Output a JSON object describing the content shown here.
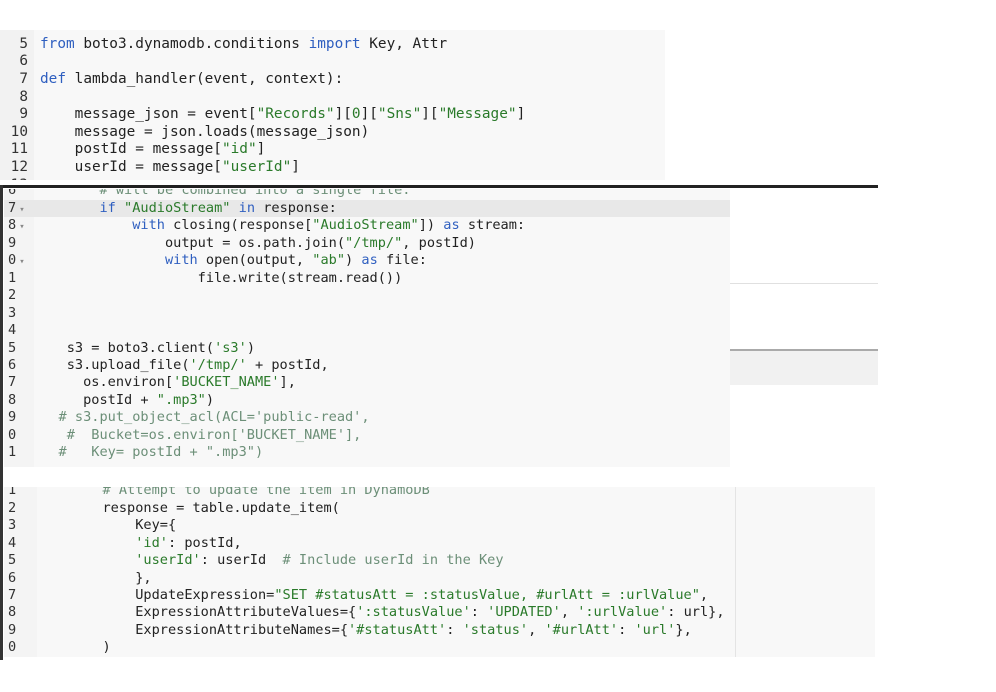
{
  "panels": [
    {
      "id": "p1",
      "lines": [
        {
          "num": "5",
          "tokens": [
            [
              "kw",
              "from"
            ],
            [
              "txt",
              " boto3.dynamodb.conditions "
            ],
            [
              "kw",
              "import"
            ],
            [
              "txt",
              " Key, Attr"
            ]
          ]
        },
        {
          "num": "6",
          "tokens": []
        },
        {
          "num": "7",
          "tokens": [
            [
              "kw",
              "def"
            ],
            [
              "txt",
              " lambda_handler(event, context):"
            ]
          ]
        },
        {
          "num": "8",
          "tokens": []
        },
        {
          "num": "9",
          "tokens": [
            [
              "txt",
              "    message_json = event["
            ],
            [
              "str",
              "\"Records\""
            ],
            [
              "txt",
              "]["
            ],
            [
              "num",
              "0"
            ],
            [
              "txt",
              "]["
            ],
            [
              "str",
              "\"Sns\""
            ],
            [
              "txt",
              "]["
            ],
            [
              "str",
              "\"Message\""
            ],
            [
              "txt",
              "]"
            ]
          ]
        },
        {
          "num": "10",
          "tokens": [
            [
              "txt",
              "    message = json.loads(message_json)"
            ]
          ]
        },
        {
          "num": "11",
          "tokens": [
            [
              "txt",
              "    postId = message["
            ],
            [
              "str",
              "\"id\""
            ],
            [
              "txt",
              "]"
            ]
          ]
        },
        {
          "num": "12",
          "tokens": [
            [
              "txt",
              "    userId = message["
            ],
            [
              "str",
              "\"userId\""
            ],
            [
              "txt",
              "]"
            ]
          ]
        },
        {
          "num": "13",
          "tokens": []
        }
      ]
    },
    {
      "id": "p2",
      "highlight_line": 1,
      "lines": [
        {
          "num": "6",
          "tokens": [
            [
              "cmt",
              "        # will be combined into a single file."
            ]
          ]
        },
        {
          "num": "7",
          "fold": true,
          "tokens": [
            [
              "txt",
              "        "
            ],
            [
              "kw",
              "if"
            ],
            [
              "txt",
              " "
            ],
            [
              "str",
              "\"AudioStream\""
            ],
            [
              "txt",
              " "
            ],
            [
              "kw",
              "in"
            ],
            [
              "txt",
              " response:"
            ]
          ]
        },
        {
          "num": "8",
          "fold": true,
          "tokens": [
            [
              "txt",
              "            "
            ],
            [
              "kw",
              "with"
            ],
            [
              "txt",
              " closing(response["
            ],
            [
              "str",
              "\"AudioStream\""
            ],
            [
              "txt",
              "]) "
            ],
            [
              "kw",
              "as"
            ],
            [
              "txt",
              " stream:"
            ]
          ]
        },
        {
          "num": "9",
          "tokens": [
            [
              "txt",
              "                output = os.path.join("
            ],
            [
              "str",
              "\"/tmp/\""
            ],
            [
              "txt",
              ", postId)"
            ]
          ]
        },
        {
          "num": "0",
          "fold": true,
          "tokens": [
            [
              "txt",
              "                "
            ],
            [
              "kw",
              "with"
            ],
            [
              "txt",
              " open(output, "
            ],
            [
              "str",
              "\"ab\""
            ],
            [
              "txt",
              ") "
            ],
            [
              "kw",
              "as"
            ],
            [
              "txt",
              " file:"
            ]
          ]
        },
        {
          "num": "1",
          "tokens": [
            [
              "txt",
              "                    file.write(stream.read())"
            ]
          ]
        },
        {
          "num": "2",
          "tokens": []
        },
        {
          "num": "3",
          "tokens": []
        },
        {
          "num": "4",
          "tokens": []
        },
        {
          "num": "5",
          "tokens": [
            [
              "txt",
              "    s3 = boto3.client("
            ],
            [
              "str",
              "'s3'"
            ],
            [
              "txt",
              ")"
            ]
          ]
        },
        {
          "num": "6",
          "tokens": [
            [
              "txt",
              "    s3.upload_file("
            ],
            [
              "str",
              "'/tmp/'"
            ],
            [
              "txt",
              " + postId,"
            ]
          ]
        },
        {
          "num": "7",
          "tokens": [
            [
              "txt",
              "      os.environ["
            ],
            [
              "str",
              "'BUCKET_NAME'"
            ],
            [
              "txt",
              "],"
            ]
          ]
        },
        {
          "num": "8",
          "tokens": [
            [
              "txt",
              "      postId + "
            ],
            [
              "str",
              "\".mp3\""
            ],
            [
              "txt",
              ")"
            ]
          ]
        },
        {
          "num": "9",
          "tokens": [
            [
              "cmt",
              "   # s3.put_object_acl(ACL='public-read',"
            ]
          ]
        },
        {
          "num": "0",
          "tokens": [
            [
              "cmt",
              "    #  Bucket=os.environ['BUCKET_NAME'],"
            ]
          ]
        },
        {
          "num": "1",
          "tokens": [
            [
              "cmt",
              "   #   Key= postId + \".mp3\")"
            ]
          ]
        }
      ]
    },
    {
      "id": "p3",
      "lines": [
        {
          "num": "1",
          "tokens": [
            [
              "cmt",
              "        # Attempt to update the item in DynamoDB"
            ]
          ]
        },
        {
          "num": "2",
          "tokens": [
            [
              "txt",
              "        response = table.update_item("
            ]
          ]
        },
        {
          "num": "3",
          "tokens": [
            [
              "txt",
              "            Key={"
            ]
          ]
        },
        {
          "num": "4",
          "tokens": [
            [
              "txt",
              "            "
            ],
            [
              "str",
              "'id'"
            ],
            [
              "txt",
              ": postId,"
            ]
          ]
        },
        {
          "num": "5",
          "tokens": [
            [
              "txt",
              "            "
            ],
            [
              "str",
              "'userId'"
            ],
            [
              "txt",
              ": userId  "
            ],
            [
              "cmt",
              "# Include userId in the Key"
            ]
          ]
        },
        {
          "num": "6",
          "tokens": [
            [
              "txt",
              "            },"
            ]
          ]
        },
        {
          "num": "7",
          "tokens": [
            [
              "txt",
              "            UpdateExpression="
            ],
            [
              "str",
              "\"SET #statusAtt = :statusValue, #urlAtt = :urlValue\""
            ],
            [
              "txt",
              ","
            ]
          ]
        },
        {
          "num": "8",
          "tokens": [
            [
              "txt",
              "            ExpressionAttributeValues={"
            ],
            [
              "str",
              "':statusValue'"
            ],
            [
              "txt",
              ": "
            ],
            [
              "str",
              "'UPDATED'"
            ],
            [
              "txt",
              ", "
            ],
            [
              "str",
              "':urlValue'"
            ],
            [
              "txt",
              ": url},"
            ]
          ]
        },
        {
          "num": "9",
          "tokens": [
            [
              "txt",
              "            ExpressionAttributeNames={"
            ],
            [
              "str",
              "'#statusAtt'"
            ],
            [
              "txt",
              ": "
            ],
            [
              "str",
              "'status'"
            ],
            [
              "txt",
              ", "
            ],
            [
              "str",
              "'#urlAtt'"
            ],
            [
              "txt",
              ": "
            ],
            [
              "str",
              "'url'"
            ],
            [
              "txt",
              "},"
            ]
          ]
        },
        {
          "num": "0",
          "tokens": [
            [
              "txt",
              "        )"
            ]
          ]
        }
      ]
    }
  ],
  "colors": {
    "keyword": "#2f5fc0",
    "string": "#2a7a2a",
    "comment": "#6c8f78",
    "text": "#222222",
    "highlight": "#e8e8e8"
  }
}
